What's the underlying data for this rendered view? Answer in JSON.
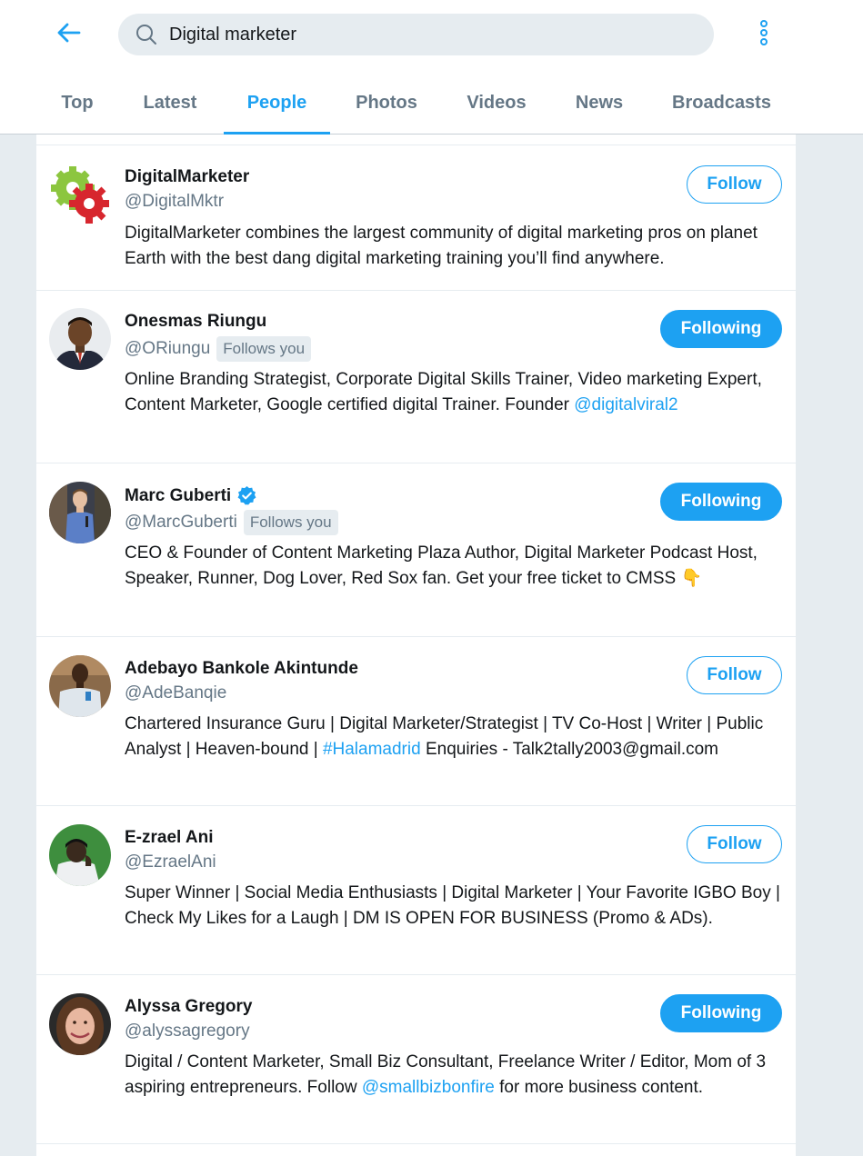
{
  "header": {
    "back_icon": "arrow-left-icon",
    "search_value": "Digital marketer",
    "more_icon": "vertical-dots-icon",
    "accent": "#1da1f2"
  },
  "tabs": [
    {
      "label": "Top",
      "active": false
    },
    {
      "label": "Latest",
      "active": false
    },
    {
      "label": "People",
      "active": true
    },
    {
      "label": "Photos",
      "active": false
    },
    {
      "label": "Videos",
      "active": false
    },
    {
      "label": "News",
      "active": false
    },
    {
      "label": "Broadcasts",
      "active": false
    }
  ],
  "people": [
    {
      "name": "DigitalMarketer",
      "handle": "@DigitalMktr",
      "button": "Follow",
      "bio_parts": [
        "DigitalMarketer combines the largest community of digital marketing pros on planet Earth with the best dang digital marketing training you’ll find anywhere."
      ]
    },
    {
      "name": "Onesmas Riungu",
      "handle": "@ORiungu",
      "follows_you": "Follows you",
      "button": "Following",
      "bio_parts": [
        "Online Branding Strategist, Corporate Digital Skills Trainer, Video marketing Expert, Content Marketer, Google certified digital Trainer. Founder ",
        "@digitalviral2"
      ]
    },
    {
      "name": "Marc Guberti",
      "handle": "@MarcGuberti",
      "follows_you": "Follows you",
      "verified_icon": "verified-badge-icon",
      "button": "Following",
      "bio_parts": [
        "CEO & Founder of Content Marketing Plaza Author, Digital Marketer Podcast Host, Speaker, Runner, Dog Lover, Red Sox fan. Get your free ticket to CMSS ",
        "👇"
      ]
    },
    {
      "name": "Adebayo Bankole Akintunde",
      "handle": "@AdeBanqie",
      "button": "Follow",
      "bio_parts": [
        "Chartered Insurance Guru | Digital Marketer/Strategist | TV Co-Host | Writer | Public Analyst | Heaven-bound | ",
        "#Halamadrid",
        " Enquiries - Talk2tally2003@gmail.com"
      ]
    },
    {
      "name": "E-zrael Ani",
      "handle": "@EzraelAni",
      "button": "Follow",
      "bio_parts": [
        "Super Winner | Social Media Enthusiasts | Digital Marketer | Your Favorite IGBO Boy | Check My Likes for a Laugh | DM IS OPEN FOR BUSINESS (Promo & ADs)."
      ]
    },
    {
      "name": "Alyssa Gregory",
      "handle": "@alyssagregory",
      "button": "Following",
      "bio_parts": [
        "Digital / Content Marketer, Small Biz Consultant, Freelance Writer / Editor, Mom of 3 aspiring entrepreneurs. Follow ",
        "@smallbizbonfire",
        " for more business content."
      ]
    }
  ]
}
